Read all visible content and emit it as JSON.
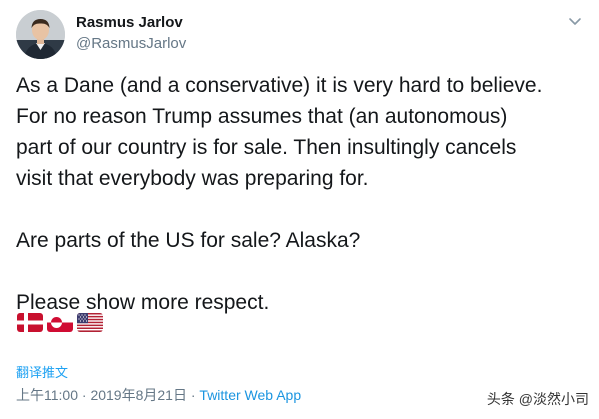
{
  "author": {
    "display_name": "Rasmus Jarlov",
    "handle": "@RasmusJarlov"
  },
  "tweet": {
    "lines": [
      "As a Dane (and a conservative) it is very hard to believe.",
      "For no reason Trump assumes that (an autonomous)",
      "part of our country is for sale. Then insultingly cancels",
      "visit that everybody was preparing for.",
      "Are parts of the US for sale? Alaska?",
      "Please show more respect."
    ],
    "flags": [
      "flag-denmark-icon",
      "flag-greenland-icon",
      "flag-usa-icon"
    ]
  },
  "translate_label": "翻译推文",
  "meta": {
    "time": "上午11:00",
    "separator": "·",
    "date": "2019年8月21日",
    "source": "Twitter Web App"
  },
  "watermark": "头条 @淡然小司",
  "colors": {
    "text": "#14171a",
    "secondary": "#657786",
    "link": "#1da1f2",
    "source_link": "#1b95e0"
  },
  "icons": {
    "menu": "chevron-down-icon"
  }
}
